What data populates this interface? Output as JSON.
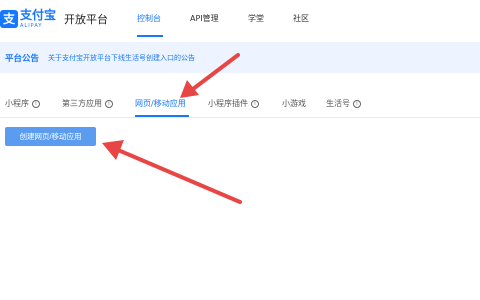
{
  "header": {
    "logo_text_cn": "支付宝",
    "logo_text_en": "ALIPAY",
    "logo_glyph": "支",
    "platform_title": "开放平台",
    "nav": [
      {
        "label": "控制台",
        "active": true
      },
      {
        "label": "API管理",
        "active": false
      },
      {
        "label": "学堂",
        "active": false
      },
      {
        "label": "社区",
        "active": false
      }
    ]
  },
  "notice": {
    "label": "平台公告",
    "text": "关于支付宝开放平台下线生活号创建入口的公告"
  },
  "tabs": [
    {
      "label": "小程序",
      "info": true,
      "active": false
    },
    {
      "label": "第三方应用",
      "info": true,
      "active": false
    },
    {
      "label": "网页/移动应用",
      "info": false,
      "active": true
    },
    {
      "label": "小程序插件",
      "info": true,
      "active": false
    },
    {
      "label": "小游戏",
      "info": false,
      "active": false
    },
    {
      "label": "生活号",
      "info": true,
      "active": false
    }
  ],
  "actions": {
    "create_label": "创建网页/移动应用"
  },
  "colors": {
    "brand": "#1677ff",
    "notice_bg": "#eef4ff",
    "button": "#5b9bf0",
    "arrow": "#e84545"
  }
}
